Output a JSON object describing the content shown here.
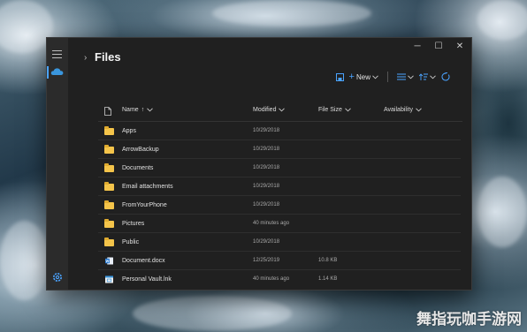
{
  "window": {
    "title": "Files",
    "controls": {
      "minimize": "─",
      "maximize": "☐",
      "close": "✕"
    }
  },
  "toolbar": {
    "new_label": "New"
  },
  "columns": {
    "name": "Name",
    "name_sort": "↑",
    "modified": "Modified",
    "file_size": "File Size",
    "availability": "Availability"
  },
  "files": [
    {
      "name": "Apps",
      "modified": "10/29/2018",
      "size": "",
      "icon": "folder-icon"
    },
    {
      "name": "ArrowBackup",
      "modified": "10/29/2018",
      "size": "",
      "icon": "folder-icon"
    },
    {
      "name": "Documents",
      "modified": "10/29/2018",
      "size": "",
      "icon": "folder-icon"
    },
    {
      "name": "Email attachments",
      "modified": "10/29/2018",
      "size": "",
      "icon": "folder-icon"
    },
    {
      "name": "FromYourPhone",
      "modified": "10/29/2018",
      "size": "",
      "icon": "folder-icon"
    },
    {
      "name": "Pictures",
      "modified": "40 minutes ago",
      "size": "",
      "icon": "folder-icon"
    },
    {
      "name": "Public",
      "modified": "10/29/2018",
      "size": "",
      "icon": "folder-icon"
    },
    {
      "name": "Document.docx",
      "modified": "12/25/2019",
      "size": "10.8 KB",
      "icon": "word-document-icon"
    },
    {
      "name": "Personal Vault.lnk",
      "modified": "40 minutes ago",
      "size": "1.14 KB",
      "icon": "shortcut-icon"
    }
  ],
  "watermark": "舞指玩咖手游网",
  "colors": {
    "accent": "#4aa3ff",
    "folder": "#f4c44a",
    "window_bg": "#202020"
  }
}
